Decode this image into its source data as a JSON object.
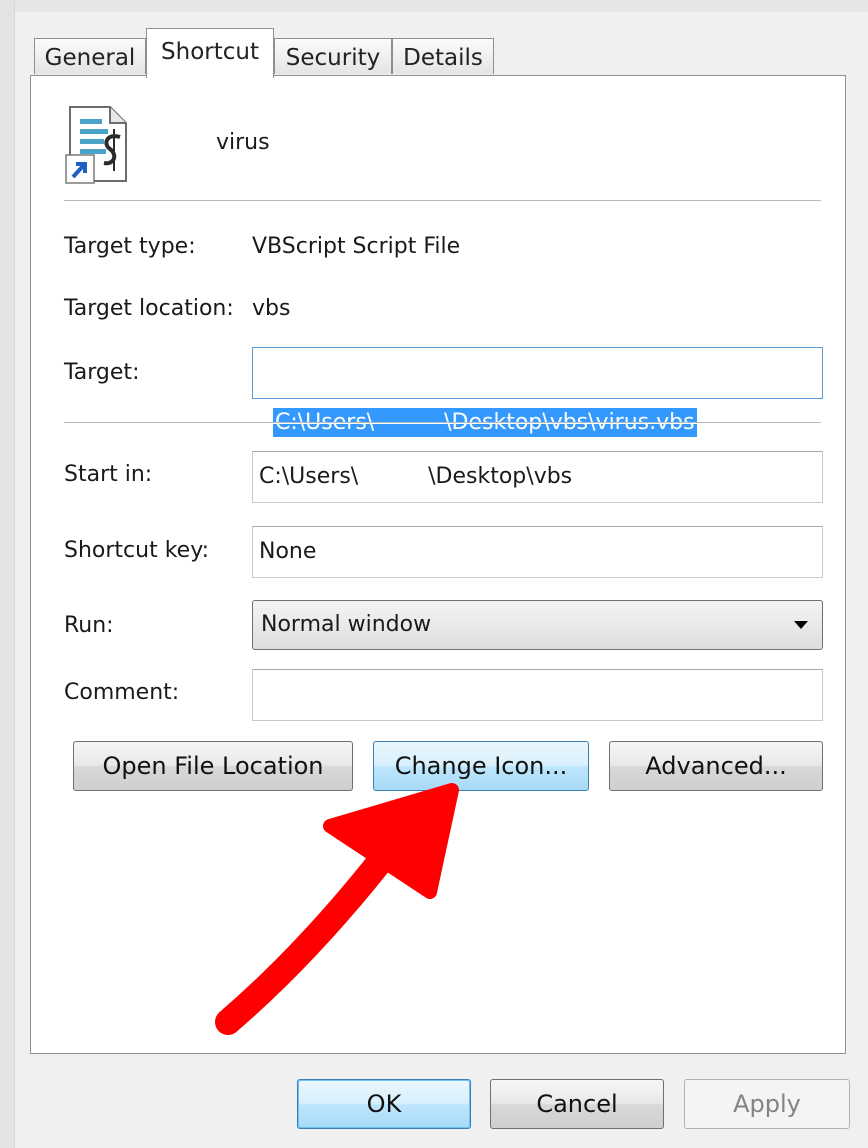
{
  "tabs": [
    {
      "label": "General"
    },
    {
      "label": "Shortcut"
    },
    {
      "label": "Security"
    },
    {
      "label": "Details"
    }
  ],
  "active_tab": "Shortcut",
  "file": {
    "name": "virus",
    "icon": "vbscript-shortcut-icon"
  },
  "fields": {
    "target_type": {
      "label": "Target type:",
      "value": "VBScript Script File"
    },
    "target_location": {
      "label": "Target location:",
      "value": "vbs"
    },
    "target": {
      "label": "Target:",
      "value": "C:\\Users\\          \\Desktop\\vbs\\virus.vbs"
    },
    "start_in": {
      "label": "Start in:",
      "value": "C:\\Users\\          \\Desktop\\vbs"
    },
    "shortcut_key": {
      "label": "Shortcut key:",
      "value": "None"
    },
    "run": {
      "label": "Run:",
      "value": "Normal window"
    },
    "comment": {
      "label": "Comment:",
      "value": ""
    }
  },
  "buttons": {
    "open_file_location": "Open File Location",
    "change_icon": "Change Icon...",
    "advanced": "Advanced...",
    "ok": "OK",
    "cancel": "Cancel",
    "apply": "Apply"
  },
  "annotation": {
    "color": "#ff0000",
    "kind": "hand-drawn-arrow",
    "points_to": "change_icon"
  }
}
